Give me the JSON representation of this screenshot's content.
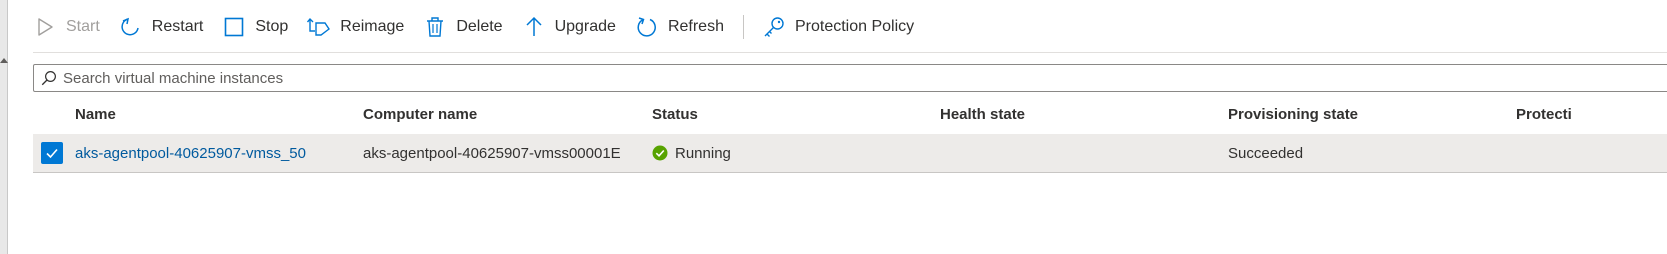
{
  "toolbar": {
    "start_label": "Start",
    "restart_label": "Restart",
    "stop_label": "Stop",
    "reimage_label": "Reimage",
    "delete_label": "Delete",
    "upgrade_label": "Upgrade",
    "refresh_label": "Refresh",
    "protection_policy_label": "Protection Policy"
  },
  "search": {
    "placeholder": "Search virtual machine instances",
    "value": ""
  },
  "grid": {
    "columns": [
      "Name",
      "Computer name",
      "Status",
      "Health state",
      "Provisioning state",
      "Protecti"
    ],
    "rows": [
      {
        "selected": true,
        "name": "aks-agentpool-40625907-vmss_50",
        "computer_name": "aks-agentpool-40625907-vmss00001E",
        "status": "Running",
        "health_state": "",
        "provisioning_state": "Succeeded",
        "protection": ""
      }
    ]
  },
  "colors": {
    "accent": "#0078d4",
    "link": "#005a9e",
    "status_running": "#57a300",
    "row_selected_bg": "#edebe9"
  },
  "icons": {
    "start": "play-icon",
    "restart": "restart-icon",
    "stop": "stop-icon",
    "reimage": "reimage-icon",
    "delete": "trash-icon",
    "upgrade": "arrow-up-icon",
    "refresh": "refresh-icon",
    "protection_policy": "key-icon",
    "search": "search-icon",
    "status": "check-circle-icon"
  }
}
